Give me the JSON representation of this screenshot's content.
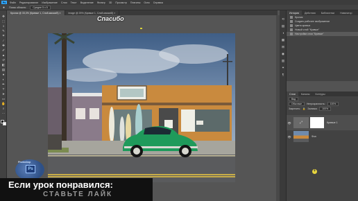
{
  "menubar": {
    "logo": "Ps",
    "items": [
      "Файл",
      "Редактирование",
      "Изображение",
      "Слои",
      "Текст",
      "Выделение",
      "Фильтр",
      "3D",
      "Просмотр",
      "Плагины",
      "Окно",
      "Справка"
    ]
  },
  "options": {
    "label": "Поиск области",
    "dropdown": "Средне 5 х 5"
  },
  "tabs": [
    {
      "label": "Кролик @ 33,3% (Кривые 1, Слой-маска/8) ×",
      "active": true
    },
    {
      "label": "image @ 25% (Кривые 1, Слой-маска/8) ×",
      "active": false
    }
  ],
  "overlay": {
    "top_subtitle": "Спасибо",
    "banner_line1": "Если урок понравился:",
    "banner_line2": "СТАВЬТЕ ЛАЙК",
    "watermark_text": "Photoshop",
    "watermark_logo": "Ps"
  },
  "history": {
    "tabs": [
      "История",
      "Действия",
      "Библиотеки",
      "Навигатор"
    ],
    "items": [
      {
        "label": "Кролик",
        "selected": false
      },
      {
        "label": "Создать рабочее изображение",
        "selected": false
      },
      {
        "label": "Цвета кривых",
        "selected": false
      },
      {
        "label": "Новый слой \"Кривые\"",
        "selected": false
      },
      {
        "label": "Настройки слоя \"Кривые\"",
        "selected": true
      }
    ]
  },
  "layers": {
    "tabs": [
      "Слои",
      "Каналы",
      "Контуры"
    ],
    "filter_label": "Вид",
    "blend_mode": "Обычные",
    "opacity_label": "Непрозрачность:",
    "opacity_value": "100%",
    "lock_label": "Закрепить:",
    "fill_label": "Заливка:",
    "fill_value": "100%",
    "items": [
      {
        "name": "Кривые 1",
        "type": "adjustment"
      },
      {
        "name": "Фон",
        "type": "image"
      }
    ]
  },
  "icons": {
    "tools": [
      "move-icon",
      "marquee-icon",
      "lasso-icon",
      "quick-select-icon",
      "crop-icon",
      "eyedropper-icon",
      "healing-icon",
      "brush-icon",
      "stamp-icon",
      "history-brush-icon",
      "eraser-icon",
      "gradient-icon",
      "blur-icon",
      "dodge-icon",
      "pen-icon",
      "type-icon",
      "path-select-icon",
      "shape-icon",
      "hand-icon",
      "zoom-icon",
      "more-icon"
    ]
  }
}
